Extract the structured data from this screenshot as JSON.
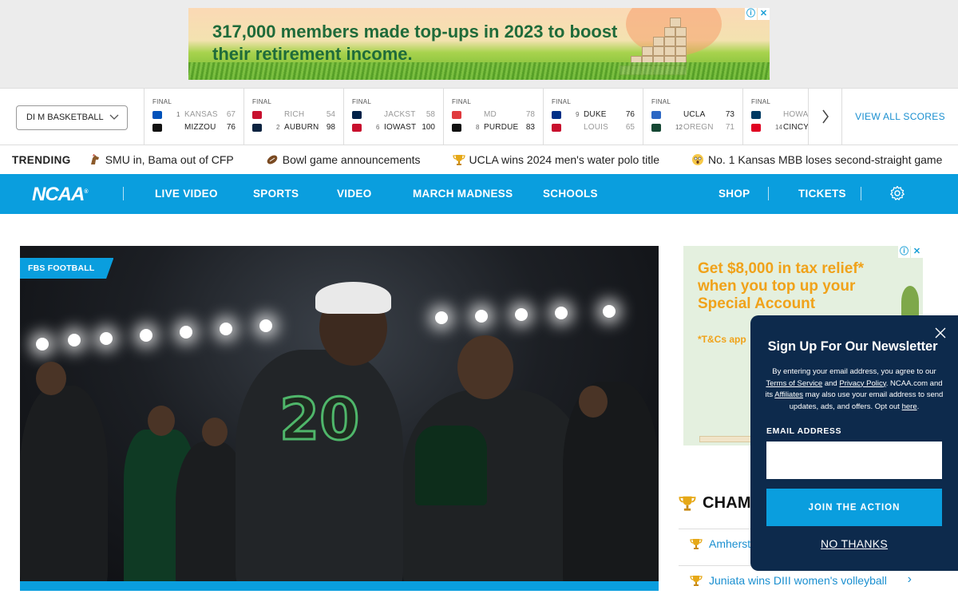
{
  "top_ad": {
    "headline": "317,000 members made top-ups in 2023 to boost their retirement income.",
    "info_glyph": "ⓘ",
    "close_glyph": "✕"
  },
  "scoreboard": {
    "sport_select": "DI M BASKETBALL",
    "view_all": "VIEW ALL SCORES",
    "games": [
      {
        "status": "FINAL",
        "teams": [
          {
            "rank": "1",
            "name": "KANSAS",
            "score": "67",
            "loser": true,
            "color": "#0051ba"
          },
          {
            "rank": "",
            "name": "MIZZOU",
            "score": "76",
            "loser": false,
            "color": "#111111"
          }
        ]
      },
      {
        "status": "FINAL",
        "teams": [
          {
            "rank": "",
            "name": "RICH",
            "score": "54",
            "loser": true,
            "color": "#c8102e"
          },
          {
            "rank": "2",
            "name": "AUBURN",
            "score": "98",
            "loser": false,
            "color": "#0c2340"
          }
        ]
      },
      {
        "status": "FINAL",
        "teams": [
          {
            "rank": "",
            "name": "JACKST",
            "score": "58",
            "loser": true,
            "color": "#002147"
          },
          {
            "rank": "6",
            "name": "IOWAST",
            "score": "100",
            "loser": false,
            "color": "#c8102e"
          }
        ]
      },
      {
        "status": "FINAL",
        "teams": [
          {
            "rank": "",
            "name": "MD",
            "score": "78",
            "loser": true,
            "color": "#e03a3e"
          },
          {
            "rank": "8",
            "name": "PURDUE",
            "score": "83",
            "loser": false,
            "color": "#111111"
          }
        ]
      },
      {
        "status": "FINAL",
        "teams": [
          {
            "rank": "9",
            "name": "DUKE",
            "score": "76",
            "loser": false,
            "color": "#003087"
          },
          {
            "rank": "",
            "name": "LOUIS",
            "score": "65",
            "loser": true,
            "color": "#c8102e"
          }
        ]
      },
      {
        "status": "FINAL",
        "teams": [
          {
            "rank": "",
            "name": "UCLA",
            "score": "73",
            "loser": false,
            "color": "#2d68c4"
          },
          {
            "rank": "12",
            "name": "OREGN",
            "score": "71",
            "loser": true,
            "color": "#154733"
          }
        ]
      },
      {
        "status": "FINAL",
        "teams": [
          {
            "rank": "",
            "name": "HOWA",
            "score": "",
            "loser": true,
            "color": "#003a63"
          },
          {
            "rank": "14",
            "name": "CINCY",
            "score": "",
            "loser": false,
            "color": "#e00122"
          }
        ]
      }
    ]
  },
  "trending": {
    "label": "TRENDING",
    "items": [
      {
        "icon": "mustang-icon",
        "text": "SMU in, Bama out of CFP"
      },
      {
        "icon": "football-icon",
        "text": "Bowl game announcements"
      },
      {
        "icon": "trophy-icon",
        "text": "UCLA wins 2024 men's water polo title"
      },
      {
        "icon": "shocked-face-icon",
        "text": "No. 1 Kansas MBB loses second-straight game"
      }
    ]
  },
  "nav": {
    "logo": "NCAA",
    "items": [
      "LIVE VIDEO",
      "SPORTS",
      "VIDEO",
      "MARCH MADNESS",
      "SCHOOLS"
    ],
    "right_items": [
      "SHOP",
      "TICKETS"
    ],
    "accent": "#0a9ede"
  },
  "hero": {
    "tag": "FBS FOOTBALL",
    "jersey_number": "20"
  },
  "side_ad": {
    "headline": "Get $8,000 in tax relief* when you top up your Special Account",
    "fineprint": "*T&Cs app"
  },
  "champions": {
    "heading": "CHAMP",
    "items": [
      "Amherst",
      "Juniata wins DIII women's volleyball"
    ]
  },
  "newsletter": {
    "title": "Sign Up For Our Newsletter",
    "legal_pre": "By entering your email address, you agree to our ",
    "terms": "Terms of Service",
    "and": " and ",
    "privacy": "Privacy Policy",
    "legal_mid": ". NCAA.com and its ",
    "affiliates": "Affiliates",
    "legal_post": " may also use your email address to send updates, ads, and offers. Opt out ",
    "here": "here",
    "period": ".",
    "email_label": "EMAIL ADDRESS",
    "email_value": "",
    "join": "JOIN THE ACTION",
    "no_thanks": "NO THANKS"
  }
}
